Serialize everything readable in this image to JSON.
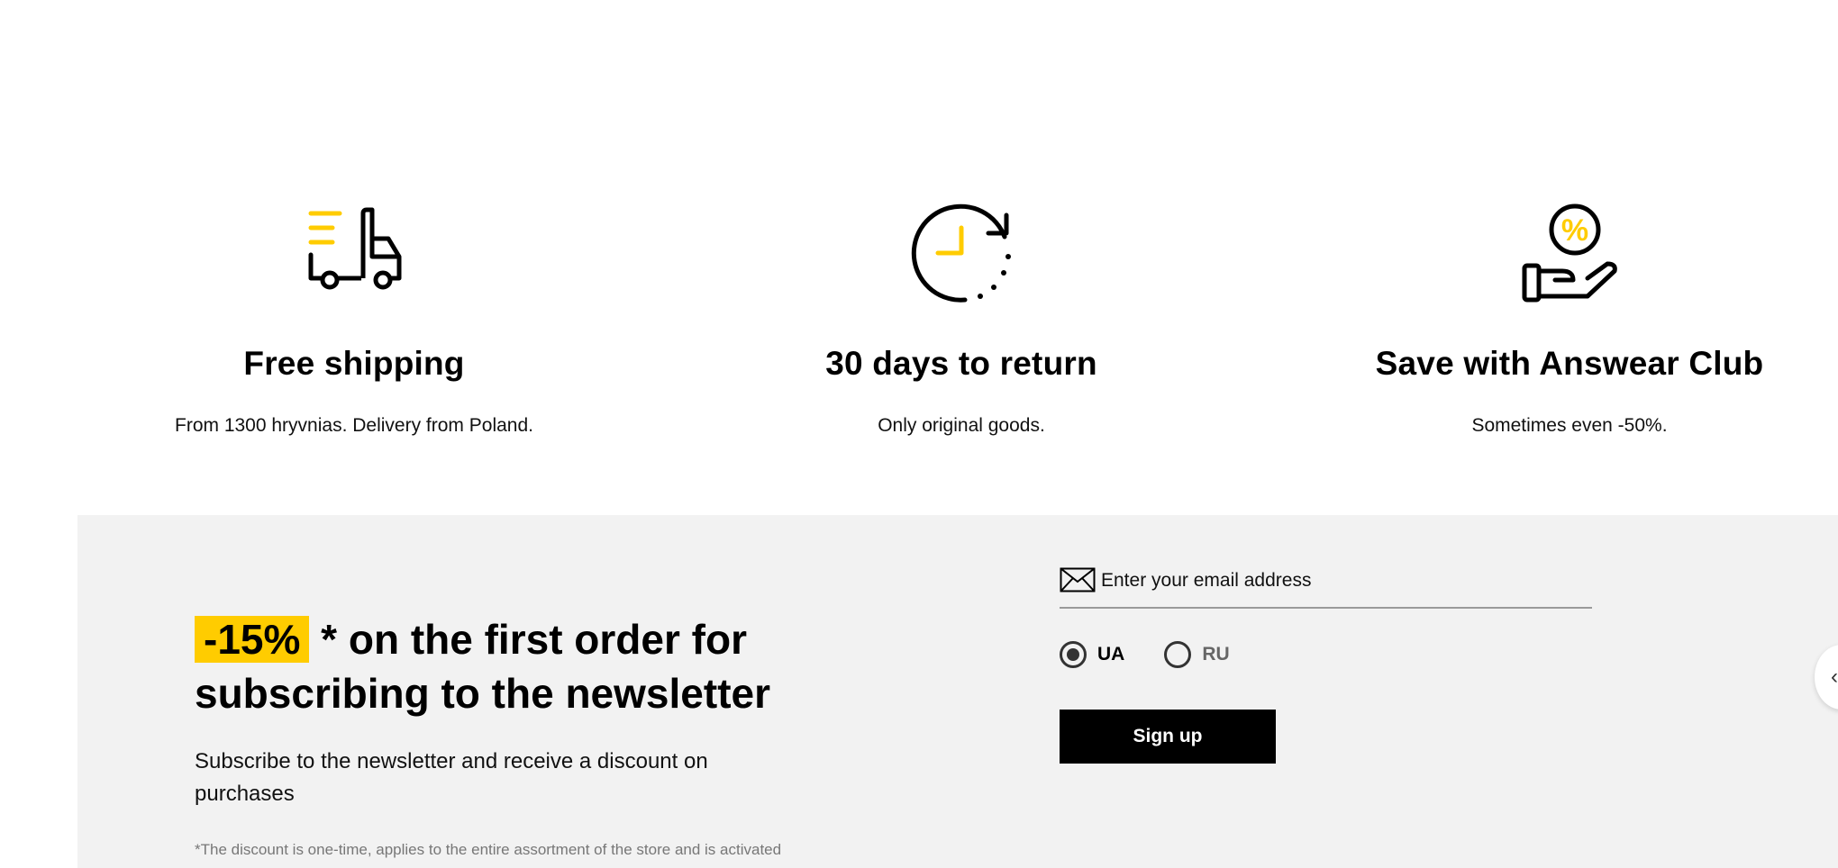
{
  "benefits": [
    {
      "icon": "truck-icon",
      "title": "Free shipping",
      "desc": "From 1300 hryvnias. Delivery from Poland."
    },
    {
      "icon": "clock-return-icon",
      "title": "30 days to return",
      "desc": "Only original goods."
    },
    {
      "icon": "hand-percent-icon",
      "title": "Save with Answear Club",
      "desc": "Sometimes even -50%."
    }
  ],
  "newsletter": {
    "discount": "-15%",
    "headline_rest": " * on the first order for subscribing to the newsletter",
    "subtext": "Subscribe to the newsletter and receive a discount on purchases",
    "footnote": "*The discount is one-time, applies to the entire assortment of the store and is activated",
    "email_placeholder": "Enter your email address",
    "lang_options": [
      {
        "label": "UA",
        "selected": true
      },
      {
        "label": "RU",
        "selected": false
      }
    ],
    "signup_label": "Sign up"
  },
  "colors": {
    "accent": "#ffcc00",
    "panel_bg": "#f2f2f2",
    "button_bg": "#000000"
  }
}
